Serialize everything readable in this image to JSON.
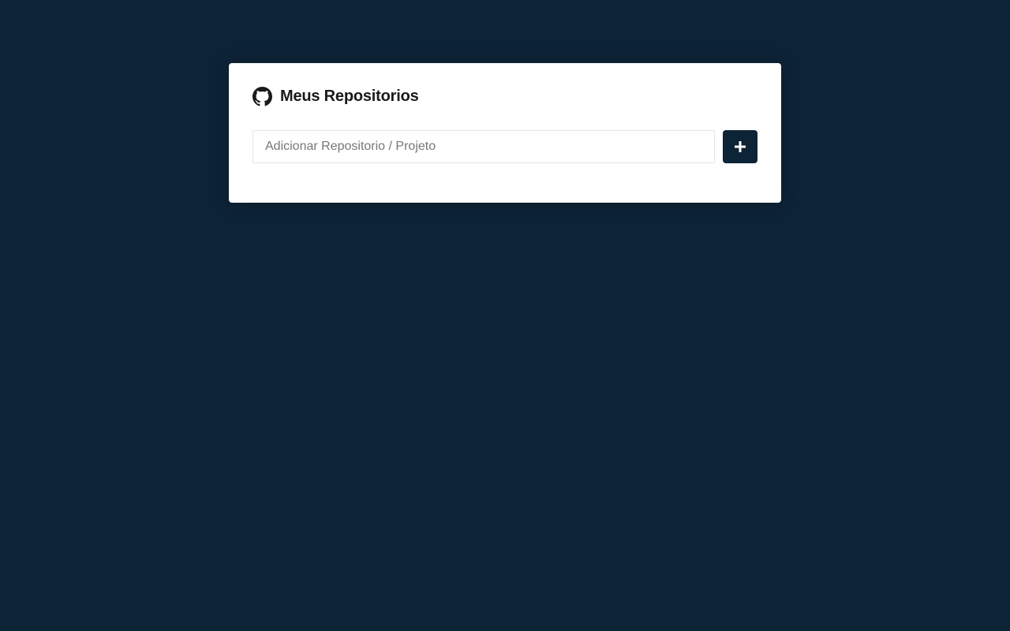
{
  "app": {
    "title": "Meus Repositorios",
    "logo_icon": "github-icon"
  },
  "form": {
    "input_value": "",
    "input_placeholder": "Adicionar Repositorio / Projeto",
    "submit_icon": "plus-icon"
  },
  "colors": {
    "background": "#0d2336",
    "card": "#ffffff",
    "button": "#0d2336",
    "title_text": "#1a1a1a"
  }
}
